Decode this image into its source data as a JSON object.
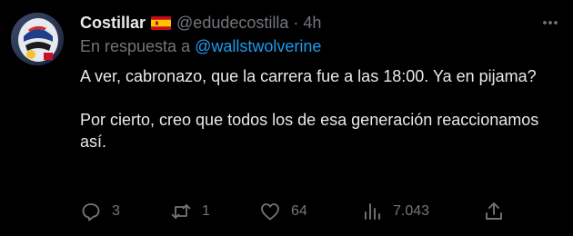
{
  "tweet": {
    "display_name": "Costillar",
    "handle": "@edudecostilla",
    "separator": "·",
    "time": "4h",
    "reply_prefix": "En respuesta a",
    "reply_to": "@wallstwolverine",
    "paragraphs": [
      "A ver, cabronazo, que la carrera fue a las 18:00. Ya en pijama?",
      "Por cierto, creo que todos los de esa generación reaccionamos así."
    ]
  },
  "actions": {
    "replies": "3",
    "retweets": "1",
    "likes": "64",
    "views": "7.043"
  },
  "icons": {
    "flag": "spain-flag-icon",
    "more": "more-options-icon",
    "reply": "reply-icon",
    "retweet": "retweet-icon",
    "like": "heart-icon",
    "views": "views-chart-icon",
    "share": "share-icon"
  },
  "colors": {
    "background": "#000000",
    "primary_text": "#e7e9ea",
    "secondary_text": "#71767b",
    "link": "#1d9bf0"
  }
}
